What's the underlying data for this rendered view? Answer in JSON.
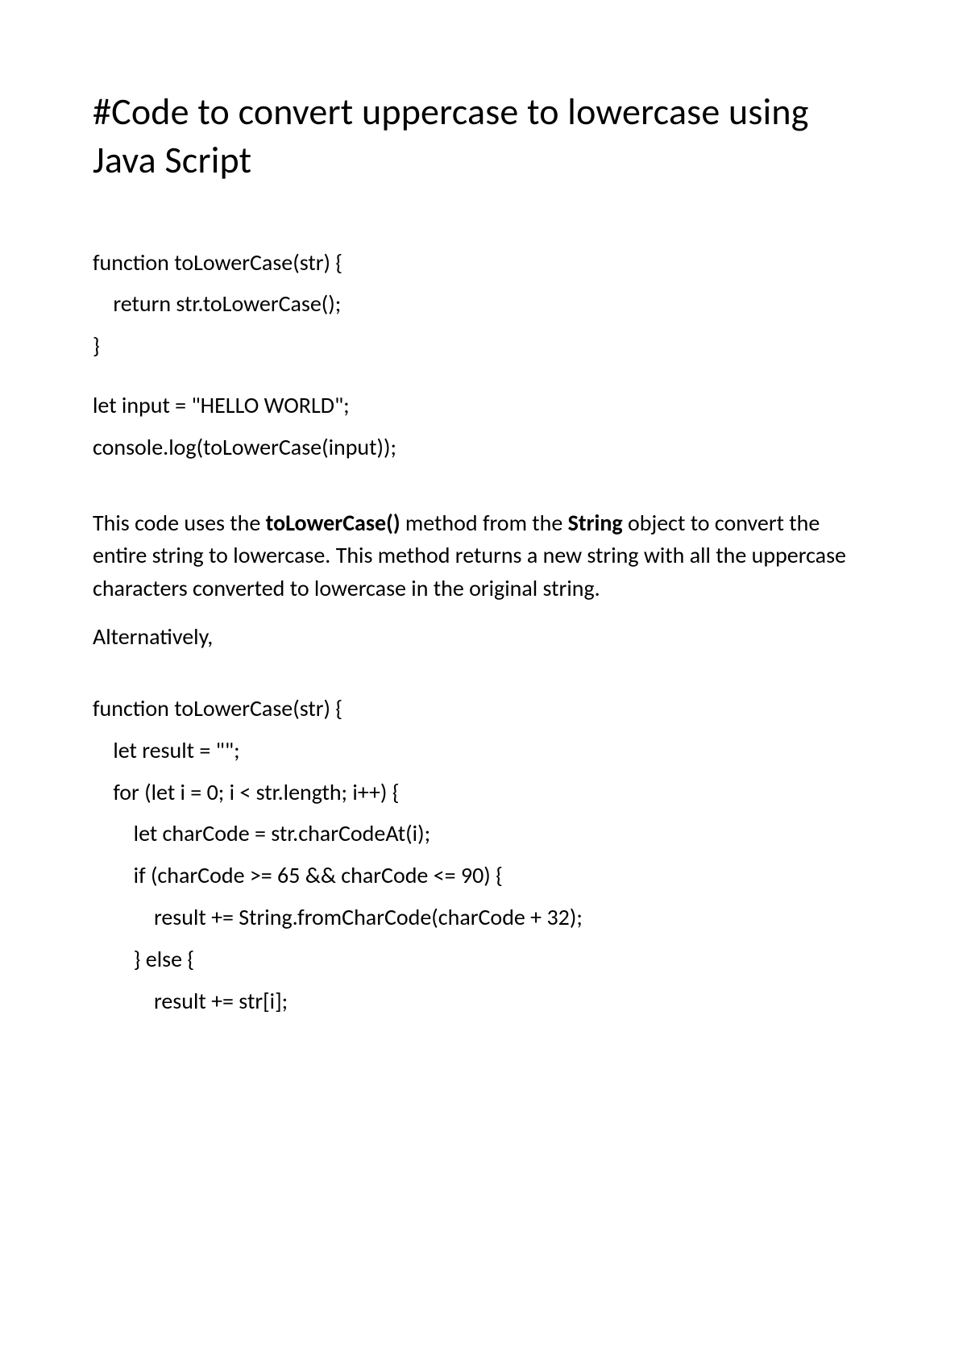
{
  "title": "#Code to convert uppercase to lowercase using Java Script",
  "code1": {
    "l1": "function toLowerCase(str) {",
    "l2": "    return str.toLowerCase();",
    "l3": "}",
    "l4": "let input = \"HELLO WORLD\";",
    "l5": "console.log(toLowerCase(input));"
  },
  "para1": {
    "t1": "This code uses the ",
    "b1": "toLowerCase()",
    "t2": " method from the ",
    "b2": "String",
    "t3": " object to convert the entire string to lowercase. This method returns a new string with all the uppercase characters converted to lowercase in the original string."
  },
  "para2": "Alternatively,",
  "code2": {
    "l1": "function toLowerCase(str) {",
    "l2": "    let result = \"\";",
    "l3": "    for (let i = 0; i < str.length; i++) {",
    "l4": "        let charCode = str.charCodeAt(i);",
    "l5": "        if (charCode >= 65 && charCode <= 90) {",
    "l6": "            result += String.fromCharCode(charCode + 32);",
    "l7": "        } else {",
    "l8": "            result += str[i];"
  }
}
